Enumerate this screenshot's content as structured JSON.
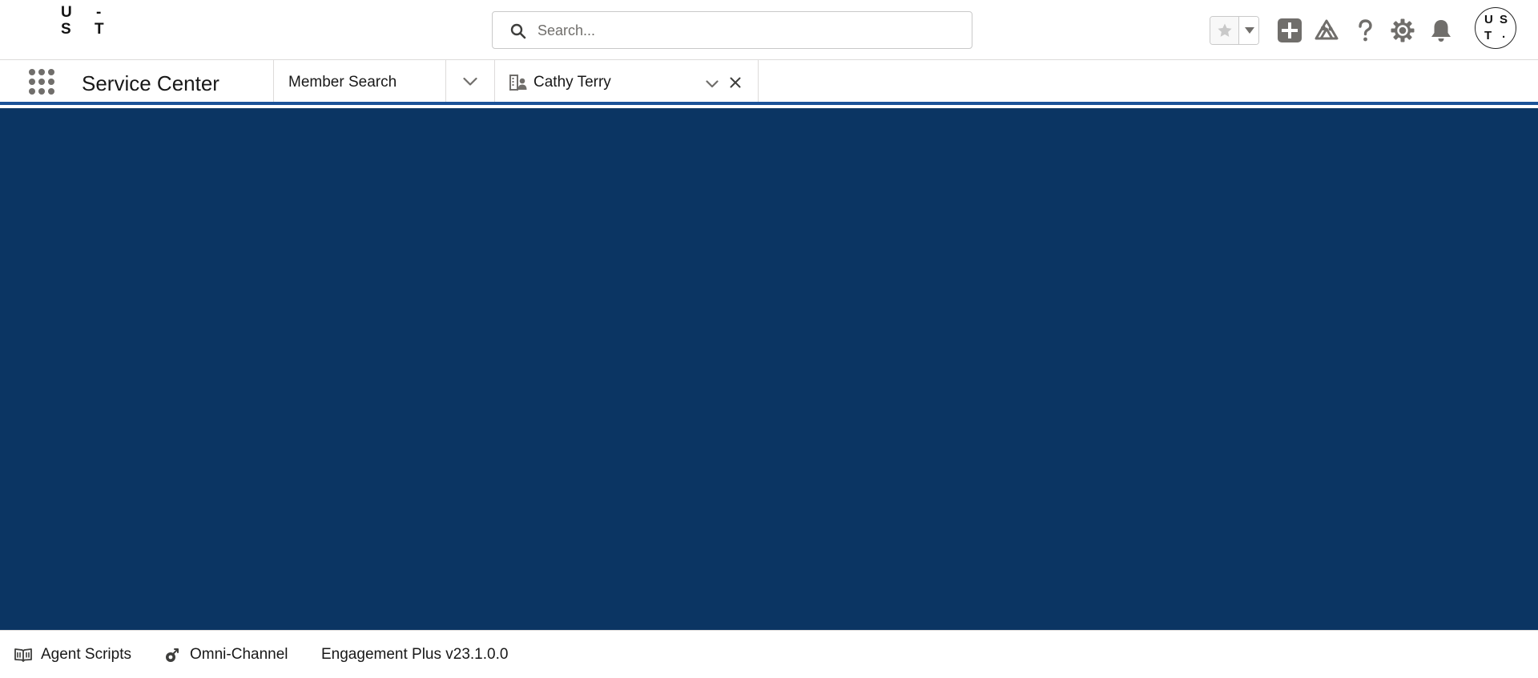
{
  "brand": {
    "logo_letters": [
      "U",
      "-",
      "S",
      "T"
    ],
    "avatar_letters": [
      "U",
      "S",
      "T",
      "."
    ],
    "accent_color": "#1b5297",
    "main_background": "#0b3563"
  },
  "header": {
    "search_placeholder": "Search...",
    "icons": [
      "star-icon",
      "chevron-down-icon",
      "add-icon",
      "trailhead-icon",
      "help-icon",
      "setup-gear-icon",
      "notifications-bell-icon",
      "avatar"
    ]
  },
  "nav": {
    "app_name": "Service Center",
    "tabs": [
      {
        "label": "Member Search",
        "closable": false
      },
      {
        "label": "Cathy Terry",
        "closable": true,
        "icon": "contact-record-icon"
      }
    ]
  },
  "utility_bar": {
    "items": [
      {
        "label": "Agent Scripts",
        "icon": "book-icon"
      },
      {
        "label": "Omni-Channel",
        "icon": "omni-channel-icon"
      },
      {
        "label": "Engagement Plus v23.1.0.0"
      }
    ]
  }
}
